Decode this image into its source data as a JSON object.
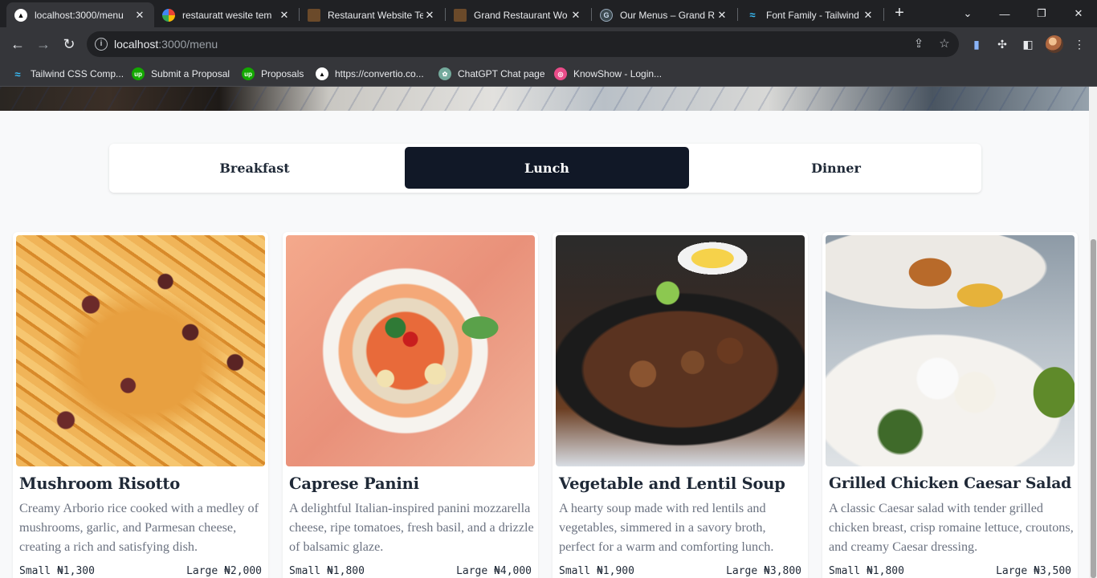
{
  "browser": {
    "tabs": [
      {
        "title": "localhost:3000/menu",
        "active": true,
        "icon": "nextjs-icon"
      },
      {
        "title": "restauratt wesite tem",
        "active": false,
        "icon": "google-icon"
      },
      {
        "title": "Restaurant Website Te",
        "active": false,
        "icon": "restaurant-site-icon"
      },
      {
        "title": "Grand Restaurant Wo",
        "active": false,
        "icon": "restaurant-site-icon"
      },
      {
        "title": "Our Menus – Grand R",
        "active": false,
        "icon": "grand-restaurant-icon"
      },
      {
        "title": "Font Family - Tailwind",
        "active": false,
        "icon": "tailwind-icon"
      }
    ],
    "address": {
      "host": "localhost",
      "path": ":3000/menu"
    },
    "bookmarks": [
      {
        "label": "Tailwind CSS Comp...",
        "icon": "tailwind-icon"
      },
      {
        "label": "Submit a Proposal",
        "icon": "upwork-icon"
      },
      {
        "label": "Proposals",
        "icon": "upwork-icon"
      },
      {
        "label": "https://convertio.co...",
        "icon": "convertio-icon"
      },
      {
        "label": "ChatGPT Chat page",
        "icon": "chatgpt-icon"
      },
      {
        "label": "KnowShow - Login...",
        "icon": "dribbble-icon"
      }
    ]
  },
  "menu": {
    "tabs": [
      "Breakfast",
      "Lunch",
      "Dinner"
    ],
    "active_tab": "Lunch"
  },
  "items": [
    {
      "name": "Mushroom Risotto",
      "description": "Creamy Arborio rice cooked with a medley of mushrooms, garlic, and Parmesan cheese, creating a rich and satisfying dish.",
      "small": "Small ₦1,300",
      "large": "Large ₦2,000"
    },
    {
      "name": "Caprese Panini",
      "description": "A delightful Italian-inspired panini mozzarella cheese, ripe tomatoes, fresh basil, and a drizzle of balsamic glaze.",
      "small": "Small ₦1,800",
      "large": "Large ₦4,000"
    },
    {
      "name": "Vegetable and Lentil Soup",
      "description": "A hearty soup made with red lentils and vegetables, simmered in a savory broth, perfect for a warm and comforting lunch.",
      "small": "Small ₦1,900",
      "large": "Large ₦3,800"
    },
    {
      "name": "Grilled Chicken Caesar Salad",
      "description": "A classic Caesar salad with tender grilled chicken breast, crisp romaine lettuce, croutons, and creamy Caesar dressing.",
      "small": "Small ₦1,800",
      "large": "Large ₦3,500"
    }
  ],
  "colors": {
    "active_tab_bg": "#111827",
    "text_dark": "#1f2937",
    "text_muted": "#6b7280",
    "page_bg": "#f8f9fa"
  }
}
